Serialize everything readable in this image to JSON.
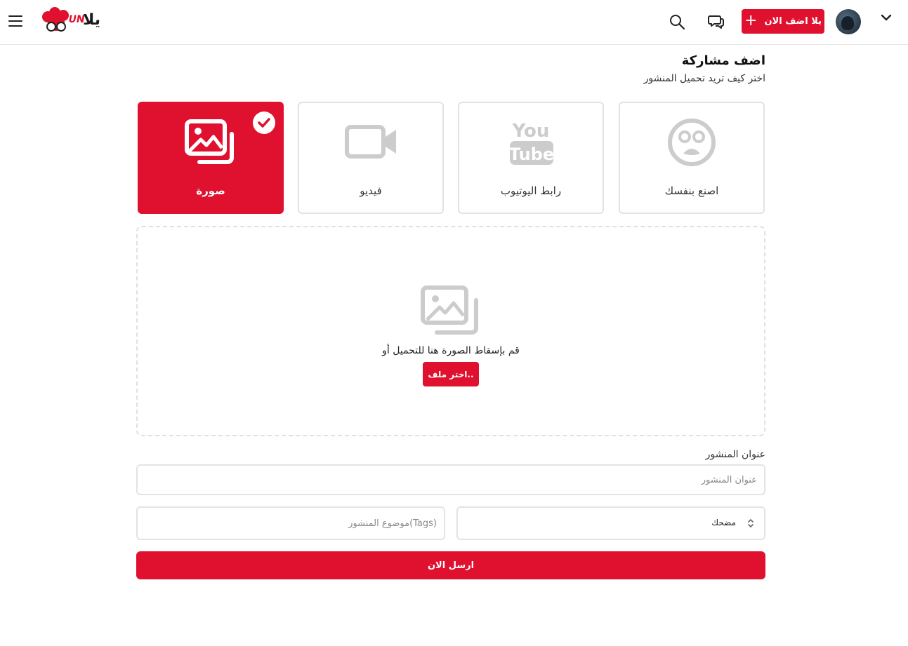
{
  "header": {
    "brand_text": "يلاFUN",
    "add_button_label": "يلا اضف الان",
    "icons": [
      "menu-icon",
      "search-icon",
      "chat-icon",
      "plus-icon",
      "chevron-down-icon"
    ]
  },
  "page": {
    "title": "اضف مشاركة",
    "subtitle": "اختر كيف تريد تحميل المنشور"
  },
  "post_types": [
    {
      "label": "صورة",
      "icon": "image-icon",
      "selected": true
    },
    {
      "label": "فيديو",
      "icon": "video-icon",
      "selected": false
    },
    {
      "label": "رابط اليوتيوب",
      "icon": "youtube-icon",
      "selected": false
    },
    {
      "label": "اصنع بنفسك",
      "icon": "meme-face-icon",
      "selected": false
    }
  ],
  "dropzone": {
    "text": "قم بإسقاط الصورة هنا للتحميل أو",
    "button_label": "اختر ملف.."
  },
  "form": {
    "title_label": "عنوان المنشور",
    "title_placeholder": "عنوان المنشور",
    "tags_placeholder": "(Tags)موضوع المنشور",
    "category_value": "مضحك",
    "submit_label": "ارسل الان"
  },
  "colors": {
    "accent": "#e0102f",
    "border": "#e2e2e2",
    "icon_gray": "#cccccc"
  }
}
